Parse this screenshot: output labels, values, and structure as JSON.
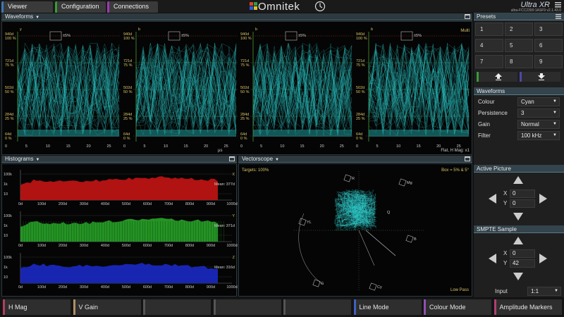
{
  "tabs": [
    {
      "label": "Viewer",
      "color": "#3c78b4"
    },
    {
      "label": "Configuration",
      "color": "#3a9a3a"
    },
    {
      "label": "Connections",
      "color": "#9a3ab4"
    }
  ],
  "brand": {
    "logo_text": "Omnitek",
    "product": "Ultra XR",
    "version": "ultra-FCC2300:1ASF9 v2.1.43.0"
  },
  "waveforms": {
    "title": "Waveforms",
    "multi": "Multi",
    "footer": "Flat, H Mag: x1",
    "us": "µs",
    "scales_left": [
      "940d",
      "100 %",
      "721d",
      "75 %",
      "502d",
      "50 %",
      "284d",
      "25 %",
      "64d",
      "0 %"
    ],
    "scales_right": [
      "940d",
      "100 %",
      "721d",
      "75 %",
      "502d",
      "50 %",
      "284d",
      "25 %",
      "64d",
      "0 %"
    ],
    "channel_labels": [
      "y",
      "b",
      "b",
      "b"
    ],
    "box_label": "±5%",
    "xticks": [
      "0",
      "5",
      "10",
      "15",
      "20",
      "25"
    ]
  },
  "histograms": {
    "title": "Histograms",
    "rows": [
      {
        "axis": "X",
        "mean": "Mean: 377d",
        "color": "#c01414"
      },
      {
        "axis": "Y",
        "mean": "Mean: 371d",
        "color": "#28a028"
      },
      {
        "axis": "Z",
        "mean": "Mean: 316d",
        "color": "#1a28c0"
      }
    ],
    "yticks": [
      "100k",
      "1k",
      "10"
    ],
    "xticks": [
      "0d",
      "100d",
      "200d",
      "300d",
      "400d",
      "500d",
      "600d",
      "700d",
      "800d",
      "900d",
      "1000d"
    ]
  },
  "vectorscope": {
    "title": "Vectorscope",
    "targets": "Targets: 100%",
    "box_note": "Box = 5% & 5°",
    "low_pass": "Low Pass",
    "labels": {
      "r": "R",
      "mg": "Mg",
      "yl": "YL",
      "b": "B",
      "g": "G",
      "cy": "Cy",
      "q": "Q"
    }
  },
  "presets": {
    "title": "Presets",
    "buttons": [
      "1",
      "2",
      "3",
      "4",
      "5",
      "6",
      "7",
      "8",
      "9"
    ]
  },
  "waveform_props": {
    "title": "Waveforms",
    "colour_label": "Colour",
    "colour_value": "Cyan",
    "persistence_label": "Persistence",
    "persistence_value": "3",
    "gain_label": "Gain",
    "gain_value": "Normal",
    "filter_label": "Filter",
    "filter_value": "100 kHz"
  },
  "active_picture": {
    "title": "Active Picture",
    "x_label": "X",
    "x_value": "0",
    "y_label": "Y",
    "y_value": "0"
  },
  "smpte_sample": {
    "title": "SMPTE Sample",
    "x_label": "X",
    "x_value": "0",
    "y_label": "Y",
    "y_value": "42",
    "input_label": "Input",
    "input_value": "1:1"
  },
  "bottom_buttons": [
    {
      "label": "H Mag",
      "color": "#b04060"
    },
    {
      "label": "V Gain",
      "color": "#b09060"
    },
    {
      "label": "",
      "color": "#555555"
    },
    {
      "label": "",
      "color": "#555555"
    },
    {
      "label": "",
      "color": "#555555"
    },
    {
      "label": "Line Mode",
      "color": "#4060c0"
    },
    {
      "label": "Colour Mode",
      "color": "#9050b0"
    },
    {
      "label": "Amplitude Markers",
      "color": "#b04070"
    }
  ]
}
